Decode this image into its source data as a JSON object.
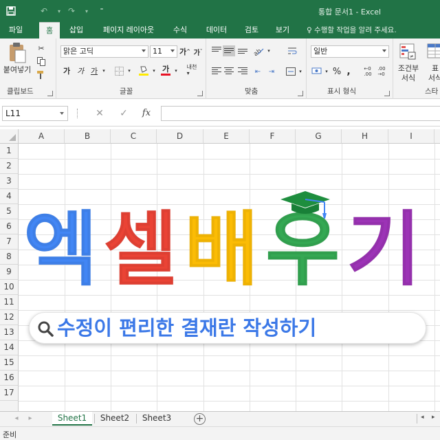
{
  "window": {
    "title": "통합 문서1 - Excel"
  },
  "ribbon_tabs": [
    {
      "label": "파일"
    },
    {
      "label": "홈"
    },
    {
      "label": "삽입"
    },
    {
      "label": "페이지 레이아웃"
    },
    {
      "label": "수식"
    },
    {
      "label": "데이터"
    },
    {
      "label": "검토"
    },
    {
      "label": "보기"
    }
  ],
  "tell_me": "수행할 작업을 알려 주세요.",
  "clipboard": {
    "paste_label": "붙여넣기",
    "group_label": "클립보드"
  },
  "font": {
    "name": "맑은 고딕",
    "size": "11",
    "group_label": "글꼴",
    "bold": "가",
    "italic": "가",
    "underline": "가",
    "grow": "가",
    "shrink": "가"
  },
  "alignment": {
    "group_label": "맞춤"
  },
  "number": {
    "format": "일반",
    "group_label": "표시 형식",
    "percent": "%",
    "comma": ","
  },
  "styles": {
    "conditional_label": "조건부\n서식",
    "conditional_l1": "조건부",
    "conditional_l2": "서식",
    "table_l1": "표",
    "table_l2": "서식",
    "group_label": "스타"
  },
  "formula_bar": {
    "name_box": "L11",
    "fx": "fx",
    "content": ""
  },
  "columns": [
    "A",
    "B",
    "C",
    "D",
    "E",
    "F",
    "G",
    "H",
    "I"
  ],
  "rows": [
    "1",
    "2",
    "3",
    "4",
    "5",
    "6",
    "7",
    "8",
    "9",
    "10",
    "11",
    "12",
    "13",
    "14",
    "15",
    "16",
    "17"
  ],
  "banner": {
    "chars": [
      "엑",
      "셀",
      "배",
      "우",
      "기"
    ],
    "subtitle": "수정이 편리한 결재란 작성하기",
    "colors": {
      "blue": "#4286f4",
      "red": "#ea4335",
      "yellow": "#fbbc05",
      "green": "#34a853",
      "purple": "#9c33b6"
    }
  },
  "sheets": [
    {
      "label": "Sheet1",
      "active": true
    },
    {
      "label": "Sheet2"
    },
    {
      "label": "Sheet3"
    }
  ],
  "status": {
    "mode": "준비"
  },
  "theme": {
    "accent": "#217346"
  }
}
